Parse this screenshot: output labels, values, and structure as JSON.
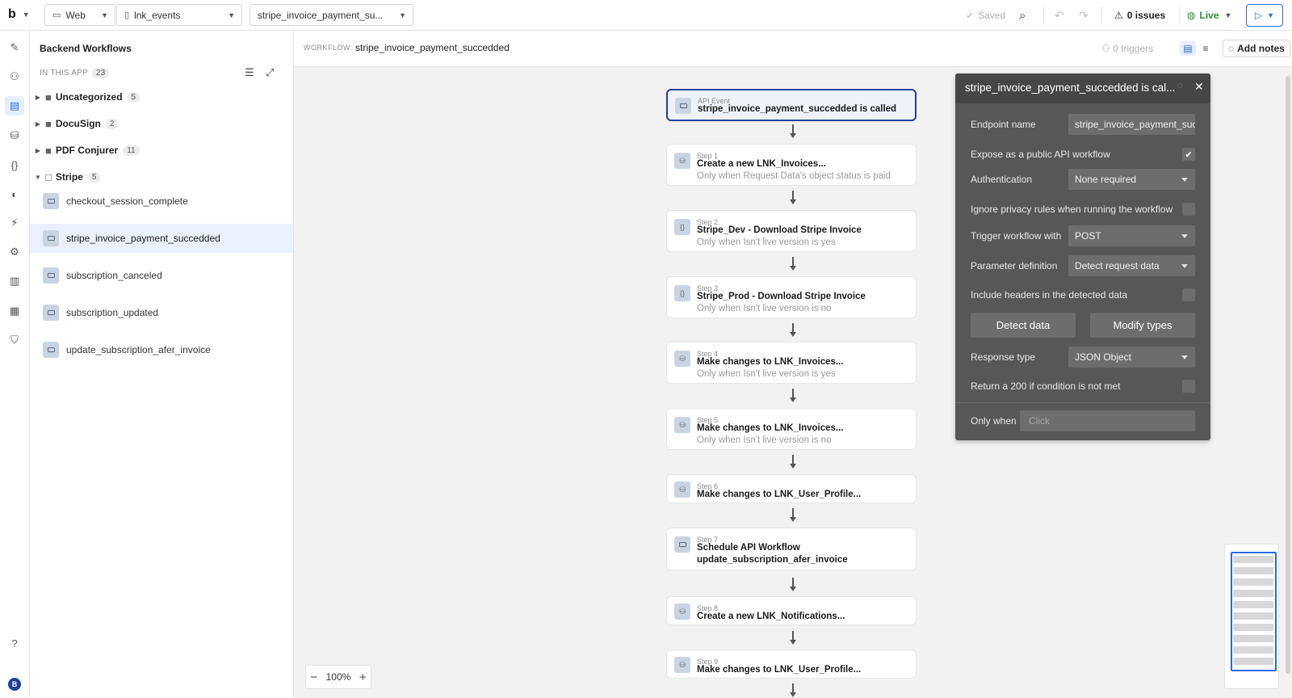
{
  "topbar": {
    "logo": "b",
    "platform": "Web",
    "page": "lnk_events",
    "workflow_select": "stripe_invoice_payment_su...",
    "saved": "Saved",
    "issues": "0 issues",
    "live": "Live"
  },
  "panel": {
    "title": "Backend Workflows",
    "in_app_label": "IN THIS APP",
    "in_app_count": "23",
    "folders": [
      {
        "label": "Uncategorized",
        "count": "5"
      },
      {
        "label": "DocuSign",
        "count": "2"
      },
      {
        "label": "PDF Conjurer",
        "count": "11"
      },
      {
        "label": "Stripe",
        "count": "5"
      }
    ],
    "workflows": [
      "checkout_session_complete",
      "stripe_invoice_payment_succedded",
      "subscription_canceled",
      "subscription_updated",
      "update_subscription_afer_invoice"
    ]
  },
  "canvas": {
    "workflow_label": "WORKFLOW:",
    "workflow_name": "stripe_invoice_payment_succedded",
    "triggers": "0 triggers",
    "add_notes": "Add notes",
    "zoom": "100%",
    "event": {
      "small": "API Event",
      "title": "stripe_invoice_payment_succedded is called"
    },
    "steps": [
      {
        "label": "Step 1",
        "title": "Create a new LNK_Invoices...",
        "cond": "Only when Request Data's object status is paid",
        "icon": "database-icon"
      },
      {
        "label": "Step 2",
        "title": "Stripe_Dev - Download Stripe Invoice",
        "cond": "Only when Isn't live version is yes",
        "icon": "braces-icon"
      },
      {
        "label": "Step 3",
        "title": "Stripe_Prod - Download Stripe Invoice",
        "cond": "Only when Isn't live version is no",
        "icon": "braces-icon"
      },
      {
        "label": "Step 4",
        "title": "Make changes to LNK_Invoices...",
        "cond": "Only when Isn't live version is yes",
        "icon": "database-icon"
      },
      {
        "label": "Step 5",
        "title": "Make changes to LNK_Invoices...",
        "cond": "Only when Isn't live version is no",
        "icon": "database-icon"
      },
      {
        "label": "Step 6",
        "title": "Make changes to LNK_User_Profile...",
        "cond": "",
        "icon": "database-icon"
      },
      {
        "label": "Step 7",
        "title": "Schedule API Workflow",
        "title2": "update_subscription_afer_invoice",
        "cond": "",
        "icon": "workflow-icon"
      },
      {
        "label": "Step 8",
        "title": "Create a new LNK_Notifications...",
        "cond": "",
        "icon": "database-icon"
      },
      {
        "label": "Step 9",
        "title": "Make changes to LNK_User_Profile...",
        "cond": "",
        "icon": "database-icon"
      }
    ]
  },
  "editor": {
    "title": "stripe_invoice_payment_succedded is cal...",
    "endpoint_label": "Endpoint name",
    "endpoint_value": "stripe_invoice_payment_succedded",
    "expose_label": "Expose as a public API workflow",
    "expose_checked": true,
    "auth_label": "Authentication",
    "auth_value": "None required",
    "ignore_privacy_label": "Ignore privacy rules when running the workflow",
    "trigger_label": "Trigger workflow with",
    "trigger_value": "POST",
    "param_label": "Parameter definition",
    "param_value": "Detect request data",
    "headers_label": "Include headers in the detected data",
    "detect_btn": "Detect data",
    "modify_btn": "Modify types",
    "response_label": "Response type",
    "response_value": "JSON Object",
    "return200_label": "Return a 200 if condition is not met",
    "only_when_label": "Only when",
    "only_when_placeholder": "Click"
  },
  "colors": {
    "accent": "#2a6be0",
    "event_border": "#1f3fa0",
    "editor_bg": "#555759",
    "live": "#2e8b3a"
  }
}
